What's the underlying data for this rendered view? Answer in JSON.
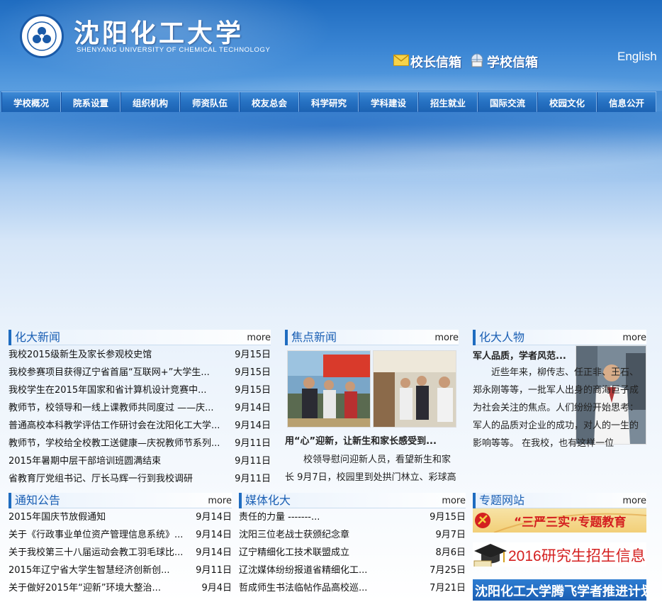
{
  "header": {
    "logo_cn": "沈阳化工大学",
    "logo_en": "SHENYANG UNIVERSITY OF CHEMICAL TECHNOLOGY",
    "mailbox_president": "校长信箱",
    "mailbox_school": "学校信箱",
    "english_link": "English"
  },
  "nav": [
    "学校概况",
    "院系设置",
    "组织机构",
    "师资队伍",
    "校友总会",
    "科学研究",
    "学科建设",
    "招生就业",
    "国际交流",
    "校园文化",
    "信息公开"
  ],
  "news": {
    "title": "化大新闻",
    "more": "more",
    "items": [
      {
        "title": "我校2015级新生及家长参观校史馆",
        "date": "9月15日"
      },
      {
        "title": "我校参赛项目获得辽宁省首届“互联网+”大学生...",
        "date": "9月15日"
      },
      {
        "title": "我校学生在2015年国家和省计算机设计竞赛中...",
        "date": "9月15日"
      },
      {
        "title": "教师节，校领导和一线上课教师共同度过 ——庆...",
        "date": "9月14日"
      },
      {
        "title": "普通高校本科教学评估工作研讨会在沈阳化工大学...",
        "date": "9月14日"
      },
      {
        "title": "教师节，学校给全校教工送健康—庆祝教师节系列...",
        "date": "9月11日"
      },
      {
        "title": "2015年暑期中层干部培训班圆满结束",
        "date": "9月11日"
      },
      {
        "title": "省教育厅党组书记、厅长马辉一行到我校调研",
        "date": "9月11日"
      }
    ]
  },
  "focus": {
    "title": "焦点新闻",
    "more": "more",
    "headline": "用“心”迎新，让新生和家长感受到...",
    "summary": "校领导慰问迎新人员，看望新生和家长 9月7日，校园里到处拱门林立、彩球高"
  },
  "people": {
    "title": "化大人物",
    "more": "more",
    "headline": "军人品质，学者风范...",
    "summary": "近些年来，柳传志、任正非、王石、郑永刚等等，一批军人出身的商海巨子成为社会关注的焦点。人们纷纷开始思考：军人的品质对企业的成功，对人的一生的影响等等。 在我校，也有这样一位"
  },
  "notice": {
    "title": "通知公告",
    "more": "more",
    "items": [
      {
        "title": "2015年国庆节放假通知",
        "date": "9月14日"
      },
      {
        "title": "关于《行政事业单位资产管理信息系统》...",
        "date": "9月14日"
      },
      {
        "title": "关于我校第三十八届运动会教工羽毛球比...",
        "date": "9月14日"
      },
      {
        "title": "2015年辽宁省大学生智慧经济创新创...",
        "date": "9月11日"
      },
      {
        "title": "关于做好2015年“迎新”环境大整治...",
        "date": "9月4日"
      }
    ]
  },
  "media": {
    "title": "媒体化大",
    "more": "more",
    "items": [
      {
        "title": "责任的力量 -------...",
        "date": "9月15日"
      },
      {
        "title": "沈阳三位老战士获颁纪念章",
        "date": "9月7日"
      },
      {
        "title": "辽宁精细化工技术联盟成立",
        "date": "8月6日"
      },
      {
        "title": "辽沈媒体纷纷报道省精细化工...",
        "date": "7月25日"
      },
      {
        "title": "哲成师生书法临帖作品高校巡...",
        "date": "7月21日"
      }
    ]
  },
  "topics": {
    "title": "专题网站",
    "more": "more",
    "banner1": "“三严三实”专题教育",
    "banner2": "2016研究生招生信息",
    "banner3": "沈阳化工大学腾飞学者推进计划"
  },
  "colors": {
    "brand_blue": "#1f6cc0",
    "title_blue": "#1a5fb4",
    "banner_red": "#d42020"
  }
}
